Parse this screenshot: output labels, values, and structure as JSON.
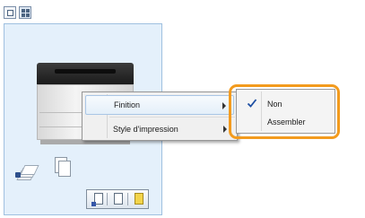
{
  "toolbar": {
    "buttons": [
      {
        "icon": "single-page-view-icon"
      },
      {
        "icon": "page-layout-view-icon"
      }
    ]
  },
  "context_menu": {
    "items": [
      {
        "label": "Finition",
        "has_submenu": true,
        "highlighted": true
      },
      {
        "label": "Style d'impression",
        "has_submenu": true,
        "highlighted": false
      }
    ]
  },
  "submenu": {
    "items": [
      {
        "label": "Non",
        "checked": true
      },
      {
        "label": "Assembler",
        "checked": false
      }
    ]
  },
  "colors": {
    "panel_background": "#e4f0fb",
    "highlight_ring": "#f39b1e",
    "menu_highlight": "#e4eff9"
  }
}
